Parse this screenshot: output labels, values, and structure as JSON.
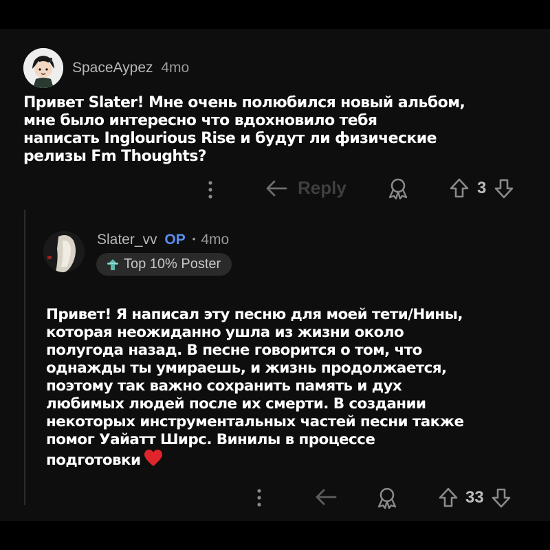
{
  "comments": [
    {
      "username": "SpaceAypez",
      "age": "4mo",
      "text": "Привет Slater! Мне очень полюбился новый альбом,\nмне было интересно  что вдохновило тебя\nнаписать Inglourious Rise и будут ли физические\nрелизы Fm Thoughts?",
      "actions": {
        "reply_label": "Reply",
        "vote_count": "3"
      }
    },
    {
      "username": "Slater_vv",
      "op_label": "OP",
      "separator": "•",
      "age": "4mo",
      "badge": "Top 10% Poster",
      "text": "Привет! Я написал эту песню для моей тети/Нины,\nкоторая неожиданно ушла из жизни около\nполугода назад. В песне говорится о том, что\nоднажды ты умираешь, и жизнь продолжается,\nпоэтому так важно сохранить память и дух\nлюбимых людей после их смерти. В создании\nнекоторых инструментальных частей песни также\nпомог Уайатт Ширс. Винилы в процессе\nподготовки",
      "actions": {
        "vote_count": "33"
      }
    }
  ],
  "colors": {
    "background": "#000000",
    "panel": "#0e0e0e",
    "op": "#5a8ef0",
    "heart": "#e0242b",
    "badge_bg": "#2a2a2a"
  },
  "icons": [
    "more-vertical-icon",
    "reply-arrow-icon",
    "award-icon",
    "upvote-icon",
    "downvote-icon",
    "heart-icon",
    "top-poster-icon"
  ]
}
